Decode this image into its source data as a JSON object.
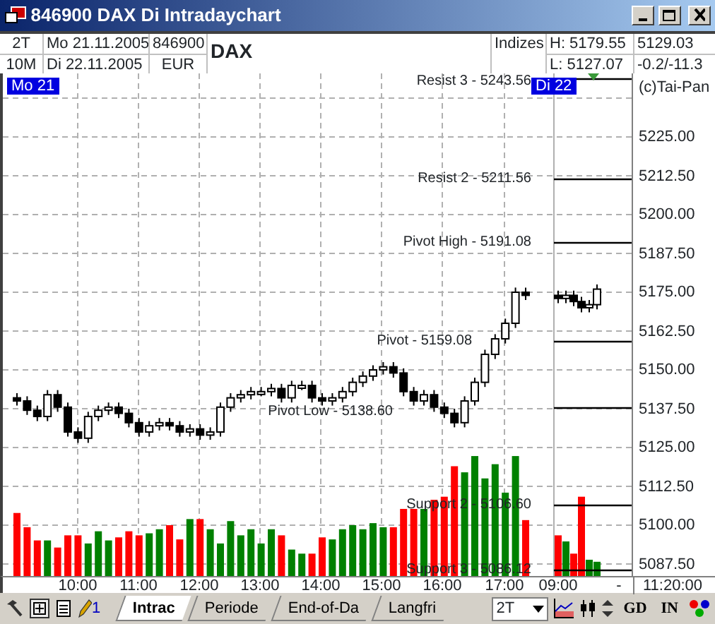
{
  "window": {
    "title": "846900 DAX  Di Intradaychart"
  },
  "header": {
    "period_top": "2T",
    "period_bottom": "10M",
    "date_from": "Mo 21.11.2005",
    "date_to": "Di 22.11.2005",
    "code": "846900",
    "currency": "EUR",
    "name": "DAX",
    "group": "Indizes",
    "high": "H: 5179.55",
    "low": "L: 5127.07",
    "last": "5129.03",
    "change": "-0.2/-11.3"
  },
  "chart": {
    "day_markers": [
      "Mo 21",
      "Di 22"
    ],
    "copyright": "(c)Tai-Pan",
    "levels": [
      {
        "label": "Resist 3 - 5243.56"
      },
      {
        "label": "Resist 2 - 5211.56"
      },
      {
        "label": "Pivot High - 5191.08"
      },
      {
        "label": "Pivot - 5159.08"
      },
      {
        "label": "Pivot Low - 5138.60"
      },
      {
        "label": "Support 2 - 5106.60"
      },
      {
        "label": "Support 3 - 5086.12"
      }
    ],
    "y_ticks": [
      "5225.00",
      "5212.50",
      "5200.00",
      "5187.50",
      "5175.00",
      "5162.50",
      "5150.00",
      "5137.50",
      "5125.00",
      "5112.50",
      "5100.00",
      "5087.50"
    ],
    "x_ticks": [
      "10:00",
      "11:00",
      "12:00",
      "13:00",
      "14:00",
      "15:00",
      "16:00",
      "17:00",
      "09:00"
    ],
    "x_dash": "-",
    "x_time": "11:20:00"
  },
  "toolbar": {
    "pen_count": "1",
    "tabs": [
      {
        "label": "Intrac",
        "selected": true
      },
      {
        "label": "Periode",
        "selected": false
      },
      {
        "label": "End-of-Da",
        "selected": false
      },
      {
        "label": "Langfri",
        "selected": false
      }
    ],
    "period": "2T",
    "buttons": [
      "GD",
      "IN"
    ]
  }
}
